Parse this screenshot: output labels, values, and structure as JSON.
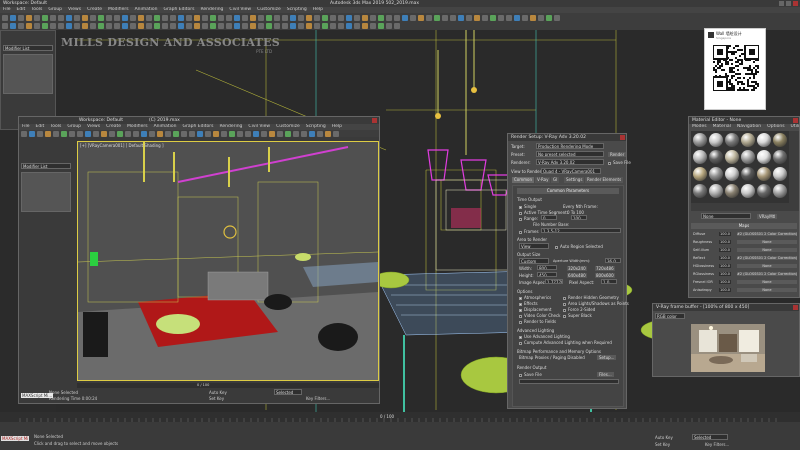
{
  "main_window": {
    "title_left": "Workspace: Default",
    "title_center": "Autodesk 3ds Max 2019   502_2019.max",
    "menu": [
      "File",
      "Edit",
      "Tools",
      "Group",
      "Views",
      "Create",
      "Modifiers",
      "Animation",
      "Graph Editors",
      "Rendering",
      "Civil View",
      "Customize",
      "Scripting",
      "Help"
    ],
    "modifier_list": "Modifier List"
  },
  "logo": {
    "line1": "MILLS DESIGN AND ASSOCIATES",
    "line2": "PTE LTD"
  },
  "wechat": {
    "name": "Wall 墙绘设计",
    "sub": "Singapore"
  },
  "inner_window": {
    "title": "(C) 2019.max",
    "workspace": "Workspace: Default",
    "menu": [
      "File",
      "Edit",
      "Tools",
      "Group",
      "Views",
      "Create",
      "Modifiers",
      "Animation",
      "Graph Editors",
      "Rendering",
      "Civil View",
      "Customize",
      "Scripting",
      "Help"
    ],
    "modifier_list": "Modifier List",
    "viewport_label": "[+] [VRayCamera001] [ Default Shading ]",
    "frame_counter": "0 / 100",
    "status_left": "None Selected",
    "status_left2": "Rendering Time 0:00:24",
    "auto_key": "Auto Key",
    "selected": "Selected",
    "set_key": "Set Key",
    "key_filters": "Key Filters...",
    "maxscript": "MAXScript Mi..."
  },
  "render_setup": {
    "title": "Render Setup: V-Ray Adv 3.20.02",
    "target_label": "Target:",
    "target_value": "Production Rendering Mode",
    "preset_label": "Preset:",
    "preset_value": "No preset selected",
    "renderer_label": "Renderer:",
    "renderer_value": "V-Ray Adv 3.20.02",
    "save_file": "Save File",
    "view_label": "View to Render:",
    "view_value": "Quad 4 - VRayCamera001",
    "render_btn": "Render",
    "tabs": [
      "Common",
      "V-Ray",
      "GI",
      "Settings",
      "Render Elements"
    ],
    "rollout_common": "Common Parameters",
    "time_output": "Time Output",
    "single": "Single",
    "every_nth": "Every Nth Frame:",
    "active_segment": "Active Time Segment:",
    "active_segment_val": "0 To 100",
    "range": "Range:",
    "range_from": "0",
    "range_to": "100",
    "file_number_base": "File Number Base:",
    "frames": "Frames",
    "frames_val": "1,3,5-12",
    "area_to_render": "Area to Render",
    "area_value": "View",
    "auto_region": "Auto Region Selected",
    "output_size": "Output Size",
    "output_size_value": "Custom",
    "aperture_label": "Aperture Width(mm):",
    "aperture_val": "36.0",
    "width_label": "Width:",
    "width_val": "800",
    "height_label": "Height:",
    "height_val": "450",
    "size_a": "320x240",
    "size_b": "720x486",
    "size_c": "640x480",
    "size_d": "800x600",
    "image_aspect": "Image Aspect:",
    "image_aspect_val": "1.77778",
    "pixel_aspect": "Pixel Aspect:",
    "pixel_aspect_val": "1.0",
    "options": "Options",
    "opt_atmospherics": "Atmospherics",
    "opt_effects": "Effects",
    "opt_displacement": "Displacement",
    "opt_video_color": "Video Color Check",
    "opt_render_fields": "Render to Fields",
    "opt_render_hidden": "Render Hidden Geometry",
    "opt_area_lights": "Area Lights/Shadows as Points",
    "opt_force_2sided": "Force 2-Sided",
    "opt_super_black": "Super Black",
    "advanced_lighting": "Advanced Lighting",
    "use_adv_lighting": "Use Advanced Lighting",
    "compute_adv": "Compute Advanced Lighting when Required",
    "bitmap_perf": "Bitmap Performance and Memory Options",
    "bitmap_proxies": "Bitmap Proxies / Paging Disabled",
    "setup_btn": "Setup...",
    "render_output": "Render Output",
    "save_file_chk": "Save File",
    "files_btn": "Files..."
  },
  "material_editor": {
    "title": "Material Editor - None",
    "menu": [
      "Modes",
      "Material",
      "Navigation",
      "Options",
      "Utilities"
    ],
    "mat_name": "None",
    "mat_type": "VRayMtl",
    "rollout": "Maps",
    "maps": [
      {
        "name": "Diffuse",
        "val": "100.0",
        "map": "#2 (GLOSSS01 2 Color Correction)"
      },
      {
        "name": "Roughness",
        "val": "100.0",
        "map": "None"
      },
      {
        "name": "Self-illum",
        "val": "100.0",
        "map": "None"
      },
      {
        "name": "Reflect",
        "val": "100.0",
        "map": "#2 (GLOSSS01 2 Color Correction)"
      },
      {
        "name": "HGlossiness",
        "val": "100.0",
        "map": "None"
      },
      {
        "name": "RGlossiness",
        "val": "100.0",
        "map": "#2 (GLOSSS01 2 Color Correction)"
      },
      {
        "name": "Fresnel IOR",
        "val": "100.0",
        "map": "None"
      },
      {
        "name": "Anisotropy",
        "val": "100.0",
        "map": "None"
      }
    ]
  },
  "frame_buffer": {
    "title": "V-Ray frame buffer - [100% of 800 x 450]",
    "channel": "RGB color"
  },
  "bottom": {
    "frame_counter": "0 / 100",
    "status1": "None Selected",
    "status2": "Click and drag to select and move objects",
    "auto_key": "Auto Key",
    "selected": "Selected",
    "set_key": "Set Key",
    "key_filters": "Key Filters...",
    "maxscript": "MAXScript Mi"
  }
}
